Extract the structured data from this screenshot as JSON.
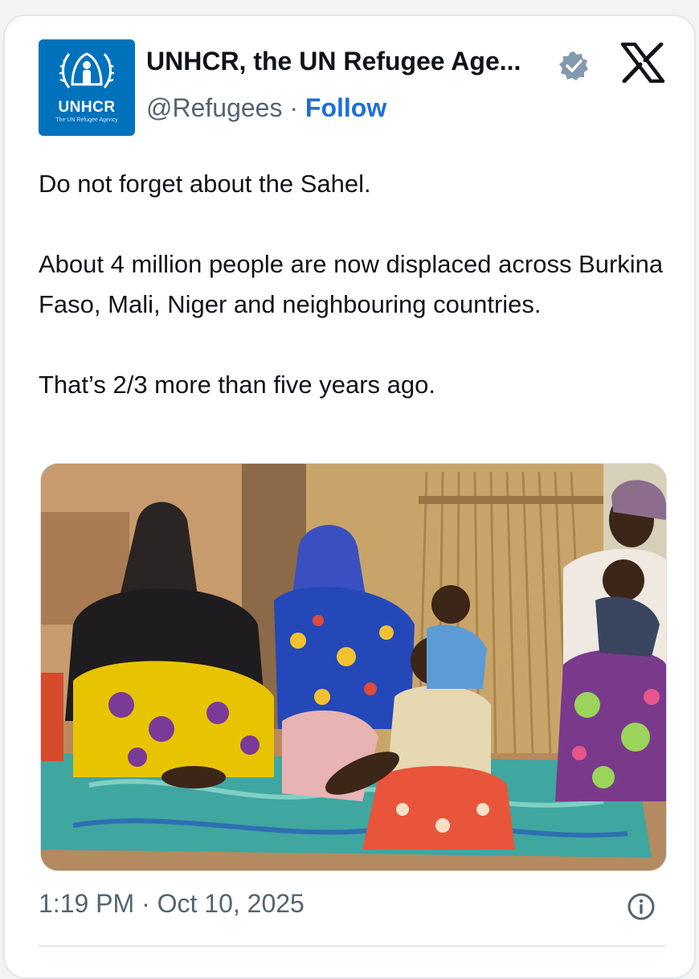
{
  "tweet": {
    "author": {
      "name": "UNHCR, the UN Refugee Age...",
      "handle": "@Refugees",
      "separator": "·",
      "follow_label": "Follow",
      "avatar": {
        "logo_word": "UNHCR",
        "logo_subtext": "The UN Refugee Agency",
        "color": "#0072bc"
      },
      "verified_icon": "verified-badge-icon"
    },
    "platform_icon": "x-logo-icon",
    "text": {
      "line1": "Do not forget about the Sahel.",
      "line2": "About 4 million people are now displaced across Burkina Faso, Mali, Niger and neighbouring countries.",
      "line3": "That’s 2/3 more than five years ago."
    },
    "timestamp": "1:19 PM · Oct 10, 2025",
    "info_icon": "info-icon"
  },
  "colors": {
    "follow": "#1d6fd8",
    "secondary_text": "#536471",
    "border": "#e3e6ea"
  }
}
